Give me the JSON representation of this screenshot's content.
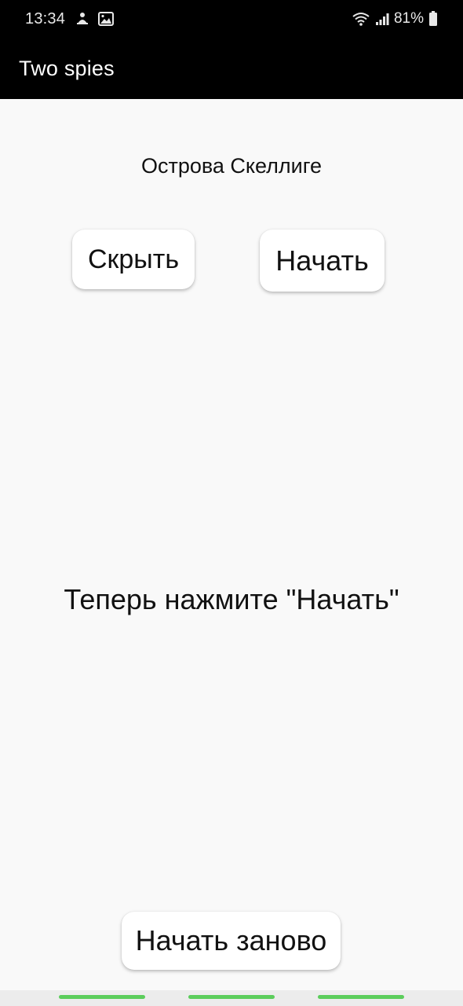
{
  "status_bar": {
    "time": "13:34",
    "left_icons": [
      "silent-mode-icon",
      "image-icon"
    ],
    "right_icons": [
      "wifi-icon",
      "signal-icon",
      "battery-icon"
    ],
    "battery_percent": "81%"
  },
  "app_bar": {
    "title": "Two spies"
  },
  "main": {
    "location": "Острова Скеллиге",
    "hide_button_label": "Скрыть",
    "start_button_label": "Начать",
    "instruction": "Теперь нажмите \"Начать\"",
    "restart_button_label": "Начать заново"
  },
  "colors": {
    "bar_background": "#000000",
    "page_background": "#f9f9f9",
    "nav_indicator": "#5ccd5c"
  }
}
